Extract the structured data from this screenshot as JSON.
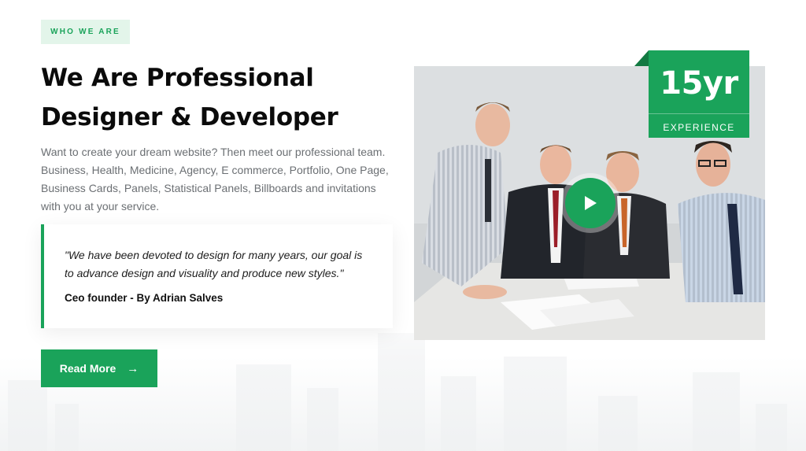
{
  "section_tag": "WHO WE ARE",
  "headline": {
    "line1": "We Are Professional",
    "line2": "Designer & Developer"
  },
  "intro_text": "Want to create your dream website? Then meet our professional team. Business, Health, Medicine, Agency, E commerce, Portfolio, One Page, Business Cards, Panels, Statistical Panels, Billboards and invitations with you at your service.",
  "quote": {
    "text": "\"We have been devoted to design for many years, our goal is to advance design and visuality and produce new styles.\"",
    "author": "Ceo founder - By Adrian Salves"
  },
  "cta": {
    "label": "Read More",
    "icon": "arrow-right-icon"
  },
  "experience": {
    "years": "15yr",
    "label": "EXPERIENCE"
  },
  "media": {
    "icon": "play-icon"
  },
  "colors": {
    "accent": "#1aa35a",
    "tag_bg": "#e3f5ea",
    "heading": "#0b0b0b",
    "body_text": "#6b6f73"
  }
}
